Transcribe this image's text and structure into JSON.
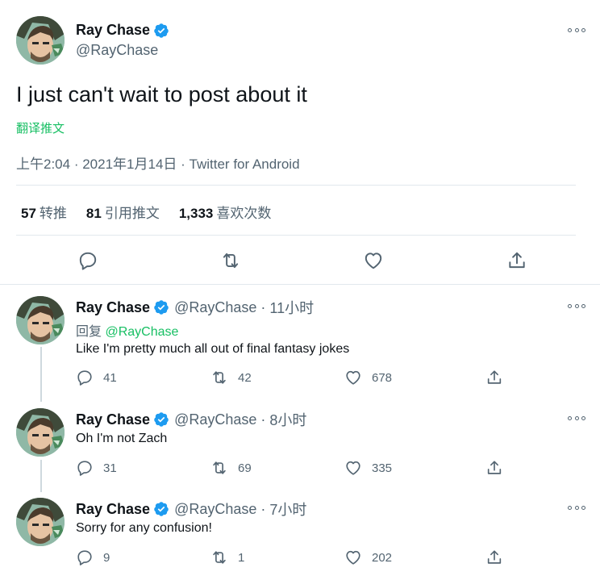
{
  "main": {
    "author_name": "Ray Chase",
    "author_handle": "@RayChase",
    "text": "I just can't wait to post about it",
    "translate_label": "翻译推文",
    "time": "上午2:04",
    "date": "2021年1月14日",
    "source": "Twitter for Android",
    "stats": {
      "retweets_count": "57",
      "retweets_label": "转推",
      "quotes_count": "81",
      "quotes_label": "引用推文",
      "likes_count": "1,333",
      "likes_label": "喜欢次数"
    }
  },
  "replies": [
    {
      "name": "Ray Chase",
      "handle": "@RayChase",
      "time": "11小时",
      "reply_prefix": "回复",
      "reply_mention": "@RayChase",
      "text": "Like I'm pretty much all out of final fantasy jokes",
      "replies": "41",
      "retweets": "42",
      "likes": "678"
    },
    {
      "name": "Ray Chase",
      "handle": "@RayChase",
      "time": "8小时",
      "text": "Oh I'm not Zach",
      "replies": "31",
      "retweets": "69",
      "likes": "335"
    },
    {
      "name": "Ray Chase",
      "handle": "@RayChase",
      "time": "7小时",
      "text": "Sorry for any confusion!",
      "replies": "9",
      "retweets": "1",
      "likes": "202"
    }
  ],
  "colors": {
    "verified": "#1d9bf0",
    "translate": "#17bf63",
    "secondary_text": "#536471"
  }
}
